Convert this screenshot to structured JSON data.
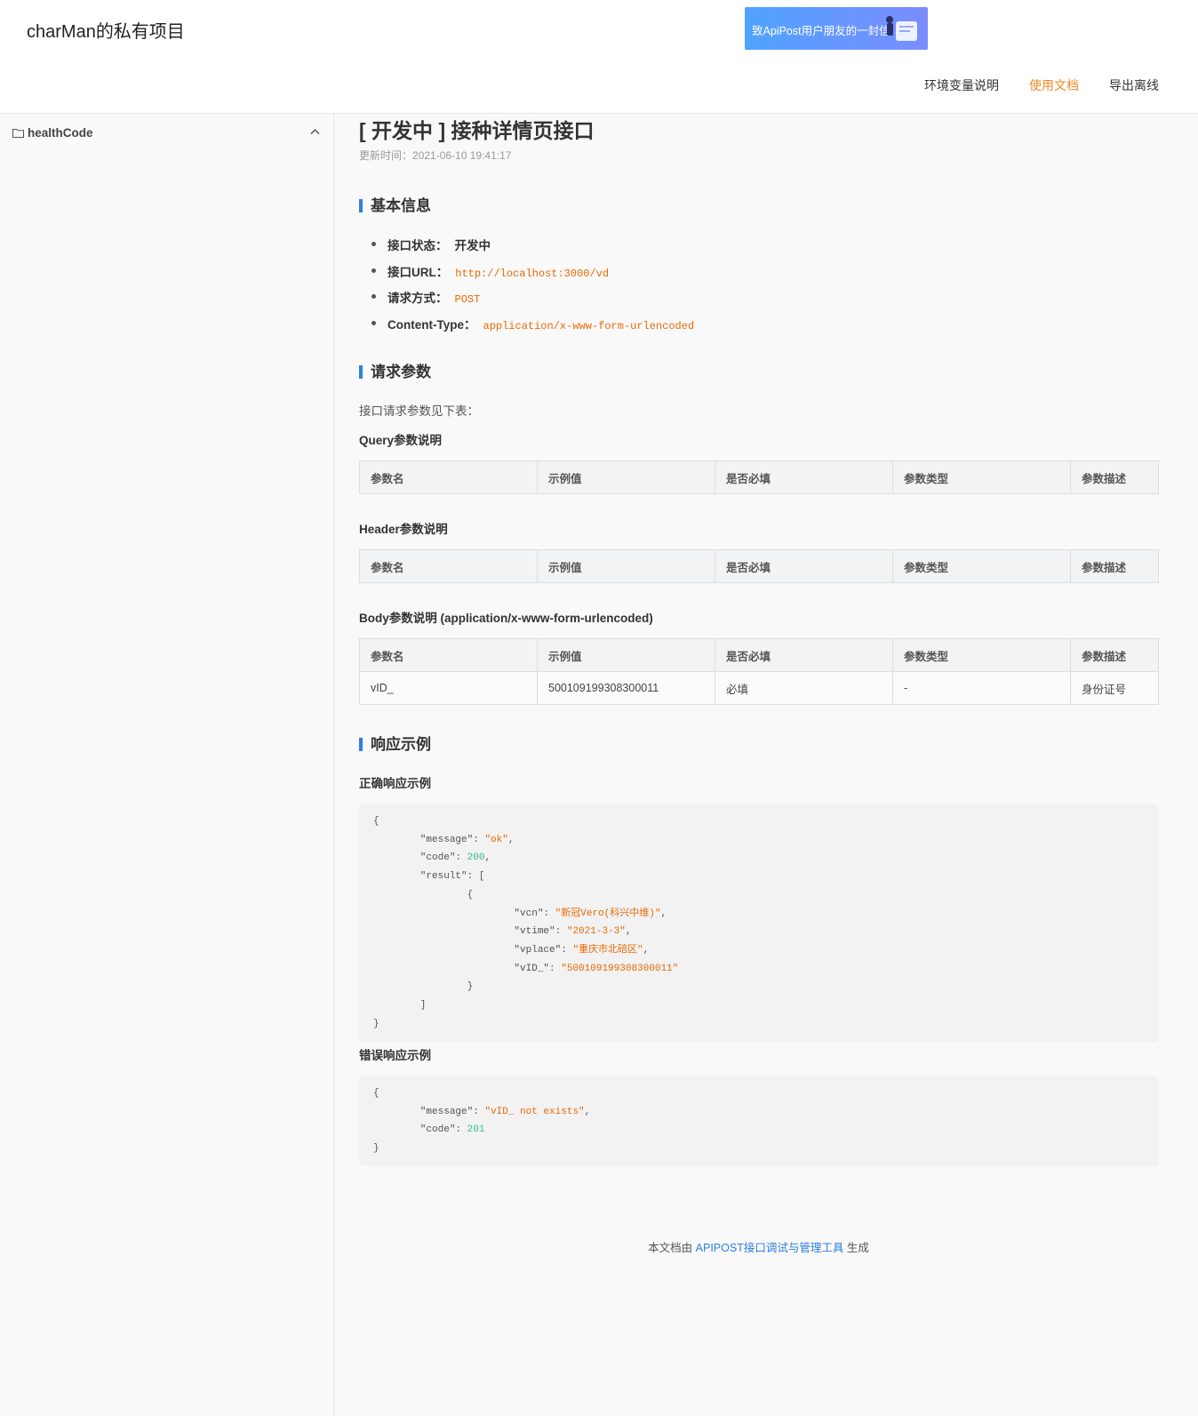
{
  "header": {
    "title": "charMan的私有项目",
    "banner_text": "致ApiPost用户朋友的一封信",
    "nav": [
      "环境变量说明",
      "使用文档",
      "导出离线"
    ]
  },
  "sidebar": {
    "folder": "healthCode"
  },
  "doc": {
    "title": "[ 开发中 ] 接种详情页接口",
    "updated": "更新时间：2021-06-10 19:41:17",
    "sections": {
      "basic": "基本信息",
      "request": "请求参数",
      "response": "响应示例"
    },
    "basic_info": {
      "status_label": "接口状态：",
      "status_value": "开发中",
      "url_label": "接口URL：",
      "url_value": "http://localhost:3000/vd",
      "method_label": "请求方式：",
      "method_value": "POST",
      "ctype_label": "Content-Type：",
      "ctype_value": "application/x-www-form-urlencoded"
    },
    "request_intro": "接口请求参数见下表：",
    "query_title": "Query参数说明",
    "header_title": "Header参数说明",
    "body_title": "Body参数说明 (application/x-www-form-urlencoded)",
    "table_columns": [
      "参数名",
      "示例值",
      "是否必填",
      "参数类型",
      "参数描述"
    ],
    "body_rows": [
      [
        "vID_",
        "500109199308300011",
        "必填",
        "-",
        "身份证号"
      ]
    ],
    "success_title": "正确响应示例",
    "error_title": "错误响应示例",
    "success_json": {
      "message": "\"ok\"",
      "code": "200",
      "vcn": "\"新冠Vero(科兴中维)\"",
      "vtime": "\"2021-3-3\"",
      "vplace": "\"重庆市北碚区\"",
      "vID_": "\"500109199308300011\""
    },
    "error_json": {
      "message": "\"vID_ not exists\"",
      "code": "201"
    },
    "footer": {
      "prefix": "本文档由 ",
      "link": "APIPOST接口调试与管理工具",
      "suffix": " 生成"
    }
  }
}
